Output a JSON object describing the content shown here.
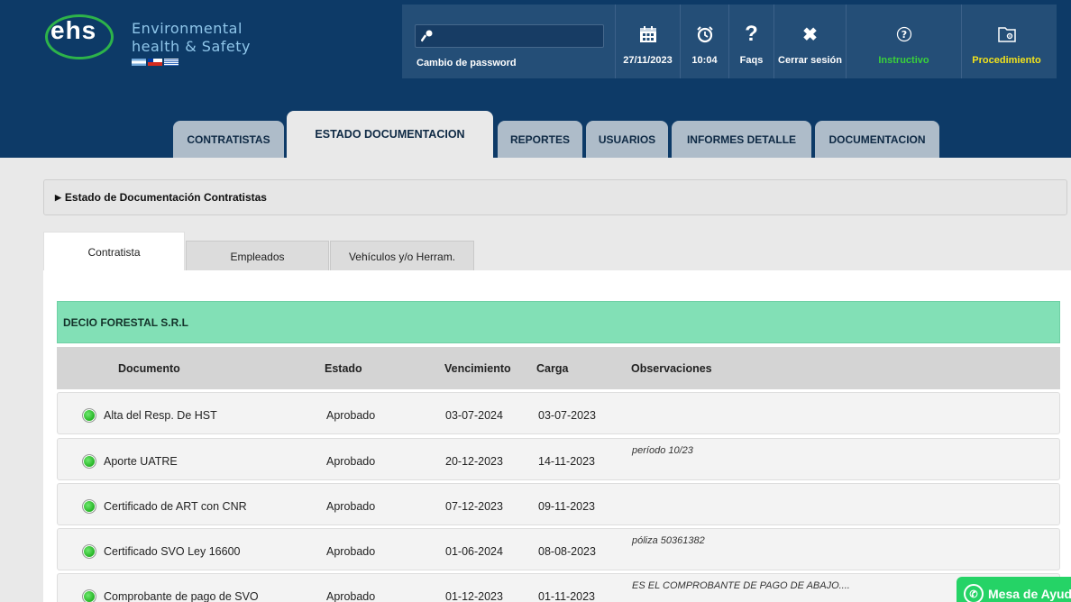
{
  "brand": {
    "logo_text": "ehs",
    "subtitle_line1": "Environmental",
    "subtitle_line2": "health & Safety"
  },
  "topbar": {
    "password_label": "Cambio de password",
    "items": [
      {
        "icon": "calendar-icon",
        "label": "27/11/2023"
      },
      {
        "icon": "alarm-clock-icon",
        "label": "10:04"
      },
      {
        "icon": "question-icon",
        "label": "Faqs"
      },
      {
        "icon": "close-icon",
        "label": "Cerrar sesión"
      },
      {
        "icon": "help-circle-icon",
        "label": "Instructivo"
      },
      {
        "icon": "folder-icon",
        "label": "Procedimiento"
      }
    ]
  },
  "nav": {
    "tabs": [
      "CONTRATISTAS",
      "ESTADO DOCUMENTACION",
      "REPORTES",
      "USUARIOS",
      "INFORMES DETALLE",
      "DOCUMENTACION"
    ],
    "active": "ESTADO DOCUMENTACION"
  },
  "section": {
    "title": "Estado de Documentación Contratistas"
  },
  "subtabs": {
    "items": [
      "Contratista",
      "Empleados",
      "Vehículos y/o Herram."
    ],
    "active": "Contratista"
  },
  "company": {
    "name": "DECIO FORESTAL S.R.L"
  },
  "table": {
    "headers": [
      "Documento",
      "Estado",
      "Vencimiento",
      "Carga",
      "Observaciones"
    ],
    "rows": [
      {
        "documento": "Alta del Resp. De HST",
        "estado": "Aprobado",
        "vencimiento": "03-07-2024",
        "carga": "03-07-2023",
        "observaciones": ""
      },
      {
        "documento": "Aporte UATRE",
        "estado": "Aprobado",
        "vencimiento": "20-12-2023",
        "carga": "14-11-2023",
        "observaciones": "período 10/23"
      },
      {
        "documento": "Certificado de ART con CNR",
        "estado": "Aprobado",
        "vencimiento": "07-12-2023",
        "carga": "09-11-2023",
        "observaciones": ""
      },
      {
        "documento": "Certificado SVO Ley 16600",
        "estado": "Aprobado",
        "vencimiento": "01-06-2024",
        "carga": "08-08-2023",
        "observaciones": "póliza 50361382"
      },
      {
        "documento": "Comprobante de pago de SVO",
        "estado": "Aprobado",
        "vencimiento": "01-12-2023",
        "carga": "01-11-2023",
        "observaciones": "ES EL COMPROBANTE DE PAGO DE ABAJO...."
      }
    ]
  },
  "help_button": {
    "label": "Mesa de Ayuda"
  }
}
